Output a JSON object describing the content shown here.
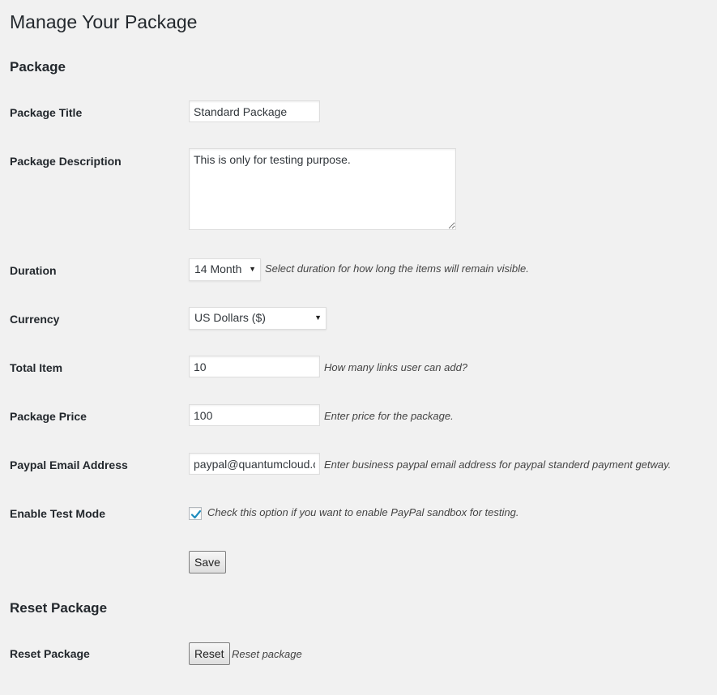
{
  "page": {
    "title": "Manage Your Package"
  },
  "sections": {
    "package": "Package",
    "reset": "Reset Package"
  },
  "fields": {
    "title": {
      "label": "Package Title",
      "value": "Standard Package"
    },
    "description": {
      "label": "Package Description",
      "value": "This is only for testing purpose."
    },
    "duration": {
      "label": "Duration",
      "selected": "14 Month",
      "help": "Select duration for how long the items will remain visible."
    },
    "currency": {
      "label": "Currency",
      "selected": "US Dollars ($)"
    },
    "total_item": {
      "label": "Total Item",
      "value": "10",
      "help": "How many links user can add?"
    },
    "price": {
      "label": "Package Price",
      "value": "100",
      "help": "Enter price for the package."
    },
    "paypal_email": {
      "label": "Paypal Email Address",
      "value": "paypal@quantumcloud.com",
      "help": "Enter business paypal email address for paypal standerd payment getway."
    },
    "test_mode": {
      "label": "Enable Test Mode",
      "checked": true,
      "help": "Check this option if you want to enable PayPal sandbox for testing."
    }
  },
  "buttons": {
    "save": "Save",
    "reset": "Reset"
  },
  "reset_row": {
    "label": "Reset Package",
    "help": "Reset package"
  },
  "colors": {
    "background": "#f1f1f1",
    "text": "#23282d",
    "checkmark": "#1e8cbe"
  },
  "icons": {
    "dropdown": "caret-down-icon",
    "checkbox": "checkmark-icon"
  }
}
